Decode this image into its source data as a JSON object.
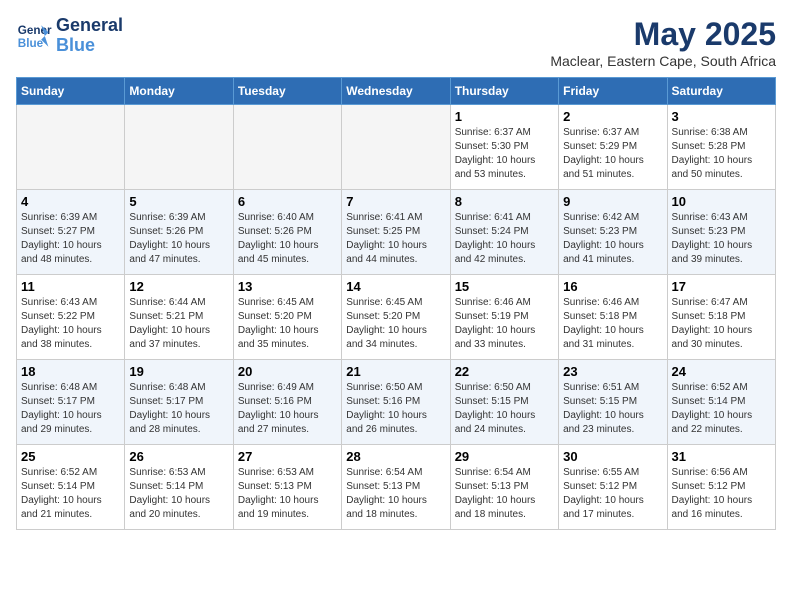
{
  "logo": {
    "line1": "General",
    "line2": "Blue"
  },
  "title": "May 2025",
  "subtitle": "Maclear, Eastern Cape, South Africa",
  "days_of_week": [
    "Sunday",
    "Monday",
    "Tuesday",
    "Wednesday",
    "Thursday",
    "Friday",
    "Saturday"
  ],
  "weeks": [
    [
      {
        "day": "",
        "sunrise": "",
        "sunset": "",
        "daylight": "",
        "empty": true
      },
      {
        "day": "",
        "sunrise": "",
        "sunset": "",
        "daylight": "",
        "empty": true
      },
      {
        "day": "",
        "sunrise": "",
        "sunset": "",
        "daylight": "",
        "empty": true
      },
      {
        "day": "",
        "sunrise": "",
        "sunset": "",
        "daylight": "",
        "empty": true
      },
      {
        "day": "1",
        "sunrise": "6:37 AM",
        "sunset": "5:30 PM",
        "daylight": "10 hours and 53 minutes.",
        "empty": false
      },
      {
        "day": "2",
        "sunrise": "6:37 AM",
        "sunset": "5:29 PM",
        "daylight": "10 hours and 51 minutes.",
        "empty": false
      },
      {
        "day": "3",
        "sunrise": "6:38 AM",
        "sunset": "5:28 PM",
        "daylight": "10 hours and 50 minutes.",
        "empty": false
      }
    ],
    [
      {
        "day": "4",
        "sunrise": "6:39 AM",
        "sunset": "5:27 PM",
        "daylight": "10 hours and 48 minutes.",
        "empty": false
      },
      {
        "day": "5",
        "sunrise": "6:39 AM",
        "sunset": "5:26 PM",
        "daylight": "10 hours and 47 minutes.",
        "empty": false
      },
      {
        "day": "6",
        "sunrise": "6:40 AM",
        "sunset": "5:26 PM",
        "daylight": "10 hours and 45 minutes.",
        "empty": false
      },
      {
        "day": "7",
        "sunrise": "6:41 AM",
        "sunset": "5:25 PM",
        "daylight": "10 hours and 44 minutes.",
        "empty": false
      },
      {
        "day": "8",
        "sunrise": "6:41 AM",
        "sunset": "5:24 PM",
        "daylight": "10 hours and 42 minutes.",
        "empty": false
      },
      {
        "day": "9",
        "sunrise": "6:42 AM",
        "sunset": "5:23 PM",
        "daylight": "10 hours and 41 minutes.",
        "empty": false
      },
      {
        "day": "10",
        "sunrise": "6:43 AM",
        "sunset": "5:23 PM",
        "daylight": "10 hours and 39 minutes.",
        "empty": false
      }
    ],
    [
      {
        "day": "11",
        "sunrise": "6:43 AM",
        "sunset": "5:22 PM",
        "daylight": "10 hours and 38 minutes.",
        "empty": false
      },
      {
        "day": "12",
        "sunrise": "6:44 AM",
        "sunset": "5:21 PM",
        "daylight": "10 hours and 37 minutes.",
        "empty": false
      },
      {
        "day": "13",
        "sunrise": "6:45 AM",
        "sunset": "5:20 PM",
        "daylight": "10 hours and 35 minutes.",
        "empty": false
      },
      {
        "day": "14",
        "sunrise": "6:45 AM",
        "sunset": "5:20 PM",
        "daylight": "10 hours and 34 minutes.",
        "empty": false
      },
      {
        "day": "15",
        "sunrise": "6:46 AM",
        "sunset": "5:19 PM",
        "daylight": "10 hours and 33 minutes.",
        "empty": false
      },
      {
        "day": "16",
        "sunrise": "6:46 AM",
        "sunset": "5:18 PM",
        "daylight": "10 hours and 31 minutes.",
        "empty": false
      },
      {
        "day": "17",
        "sunrise": "6:47 AM",
        "sunset": "5:18 PM",
        "daylight": "10 hours and 30 minutes.",
        "empty": false
      }
    ],
    [
      {
        "day": "18",
        "sunrise": "6:48 AM",
        "sunset": "5:17 PM",
        "daylight": "10 hours and 29 minutes.",
        "empty": false
      },
      {
        "day": "19",
        "sunrise": "6:48 AM",
        "sunset": "5:17 PM",
        "daylight": "10 hours and 28 minutes.",
        "empty": false
      },
      {
        "day": "20",
        "sunrise": "6:49 AM",
        "sunset": "5:16 PM",
        "daylight": "10 hours and 27 minutes.",
        "empty": false
      },
      {
        "day": "21",
        "sunrise": "6:50 AM",
        "sunset": "5:16 PM",
        "daylight": "10 hours and 26 minutes.",
        "empty": false
      },
      {
        "day": "22",
        "sunrise": "6:50 AM",
        "sunset": "5:15 PM",
        "daylight": "10 hours and 24 minutes.",
        "empty": false
      },
      {
        "day": "23",
        "sunrise": "6:51 AM",
        "sunset": "5:15 PM",
        "daylight": "10 hours and 23 minutes.",
        "empty": false
      },
      {
        "day": "24",
        "sunrise": "6:52 AM",
        "sunset": "5:14 PM",
        "daylight": "10 hours and 22 minutes.",
        "empty": false
      }
    ],
    [
      {
        "day": "25",
        "sunrise": "6:52 AM",
        "sunset": "5:14 PM",
        "daylight": "10 hours and 21 minutes.",
        "empty": false
      },
      {
        "day": "26",
        "sunrise": "6:53 AM",
        "sunset": "5:14 PM",
        "daylight": "10 hours and 20 minutes.",
        "empty": false
      },
      {
        "day": "27",
        "sunrise": "6:53 AM",
        "sunset": "5:13 PM",
        "daylight": "10 hours and 19 minutes.",
        "empty": false
      },
      {
        "day": "28",
        "sunrise": "6:54 AM",
        "sunset": "5:13 PM",
        "daylight": "10 hours and 18 minutes.",
        "empty": false
      },
      {
        "day": "29",
        "sunrise": "6:54 AM",
        "sunset": "5:13 PM",
        "daylight": "10 hours and 18 minutes.",
        "empty": false
      },
      {
        "day": "30",
        "sunrise": "6:55 AM",
        "sunset": "5:12 PM",
        "daylight": "10 hours and 17 minutes.",
        "empty": false
      },
      {
        "day": "31",
        "sunrise": "6:56 AM",
        "sunset": "5:12 PM",
        "daylight": "10 hours and 16 minutes.",
        "empty": false
      }
    ]
  ],
  "labels": {
    "sunrise": "Sunrise:",
    "sunset": "Sunset:",
    "daylight": "Daylight:"
  },
  "colors": {
    "header_bg": "#2e6db4",
    "logo_dark": "#1a3a6b",
    "logo_blue": "#4a90d9"
  }
}
